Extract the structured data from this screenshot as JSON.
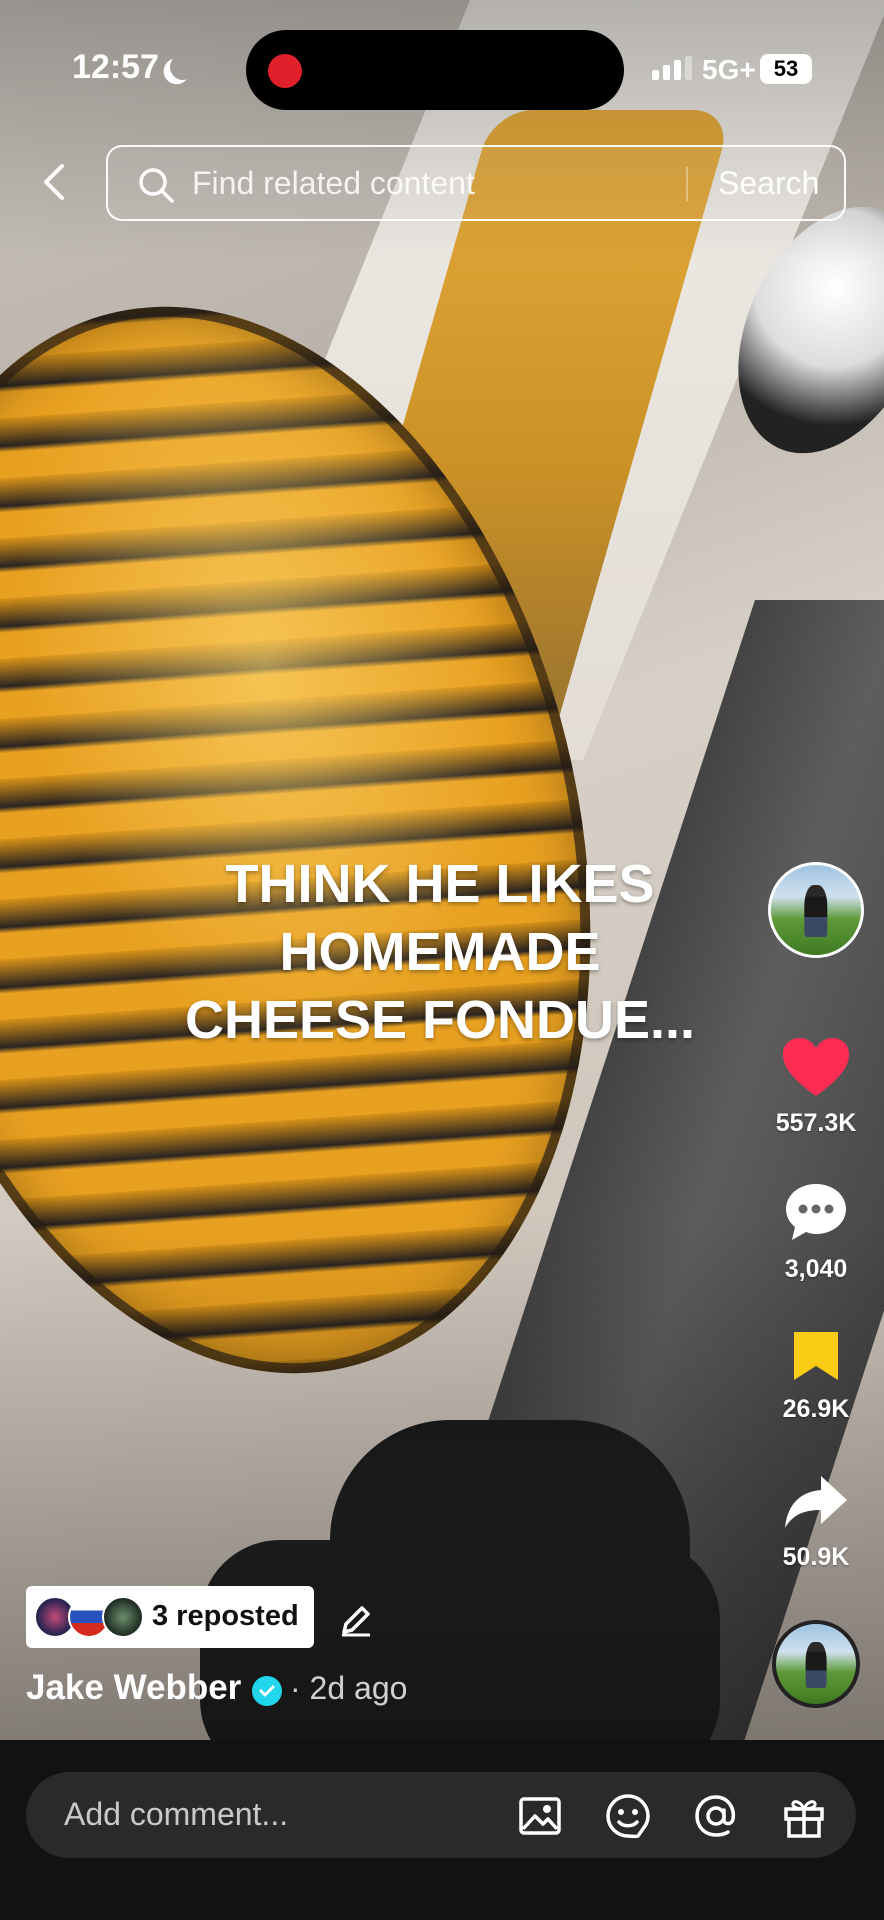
{
  "status": {
    "time": "12:57",
    "network": "5G+",
    "battery": "53"
  },
  "search": {
    "placeholder": "Find related content",
    "button": "Search"
  },
  "video": {
    "caption_lines": [
      "THINK HE LIKES",
      "HOMEMADE",
      "CHEESE FONDUE..."
    ]
  },
  "actions": {
    "likes": "557.3K",
    "comments": "3,040",
    "saves": "26.9K",
    "shares": "50.9K"
  },
  "colors": {
    "like": "#fe2c55",
    "save": "#facc15",
    "verified": "#20d5ec",
    "record": "#e0202a"
  },
  "post": {
    "repost_label": "3 reposted",
    "author": "Jake Webber",
    "age": "· 2d ago"
  },
  "comment_bar": {
    "placeholder": "Add comment...",
    "icons": [
      "image-icon",
      "emoji-sticker-icon",
      "mention-icon",
      "gift-icon"
    ]
  }
}
